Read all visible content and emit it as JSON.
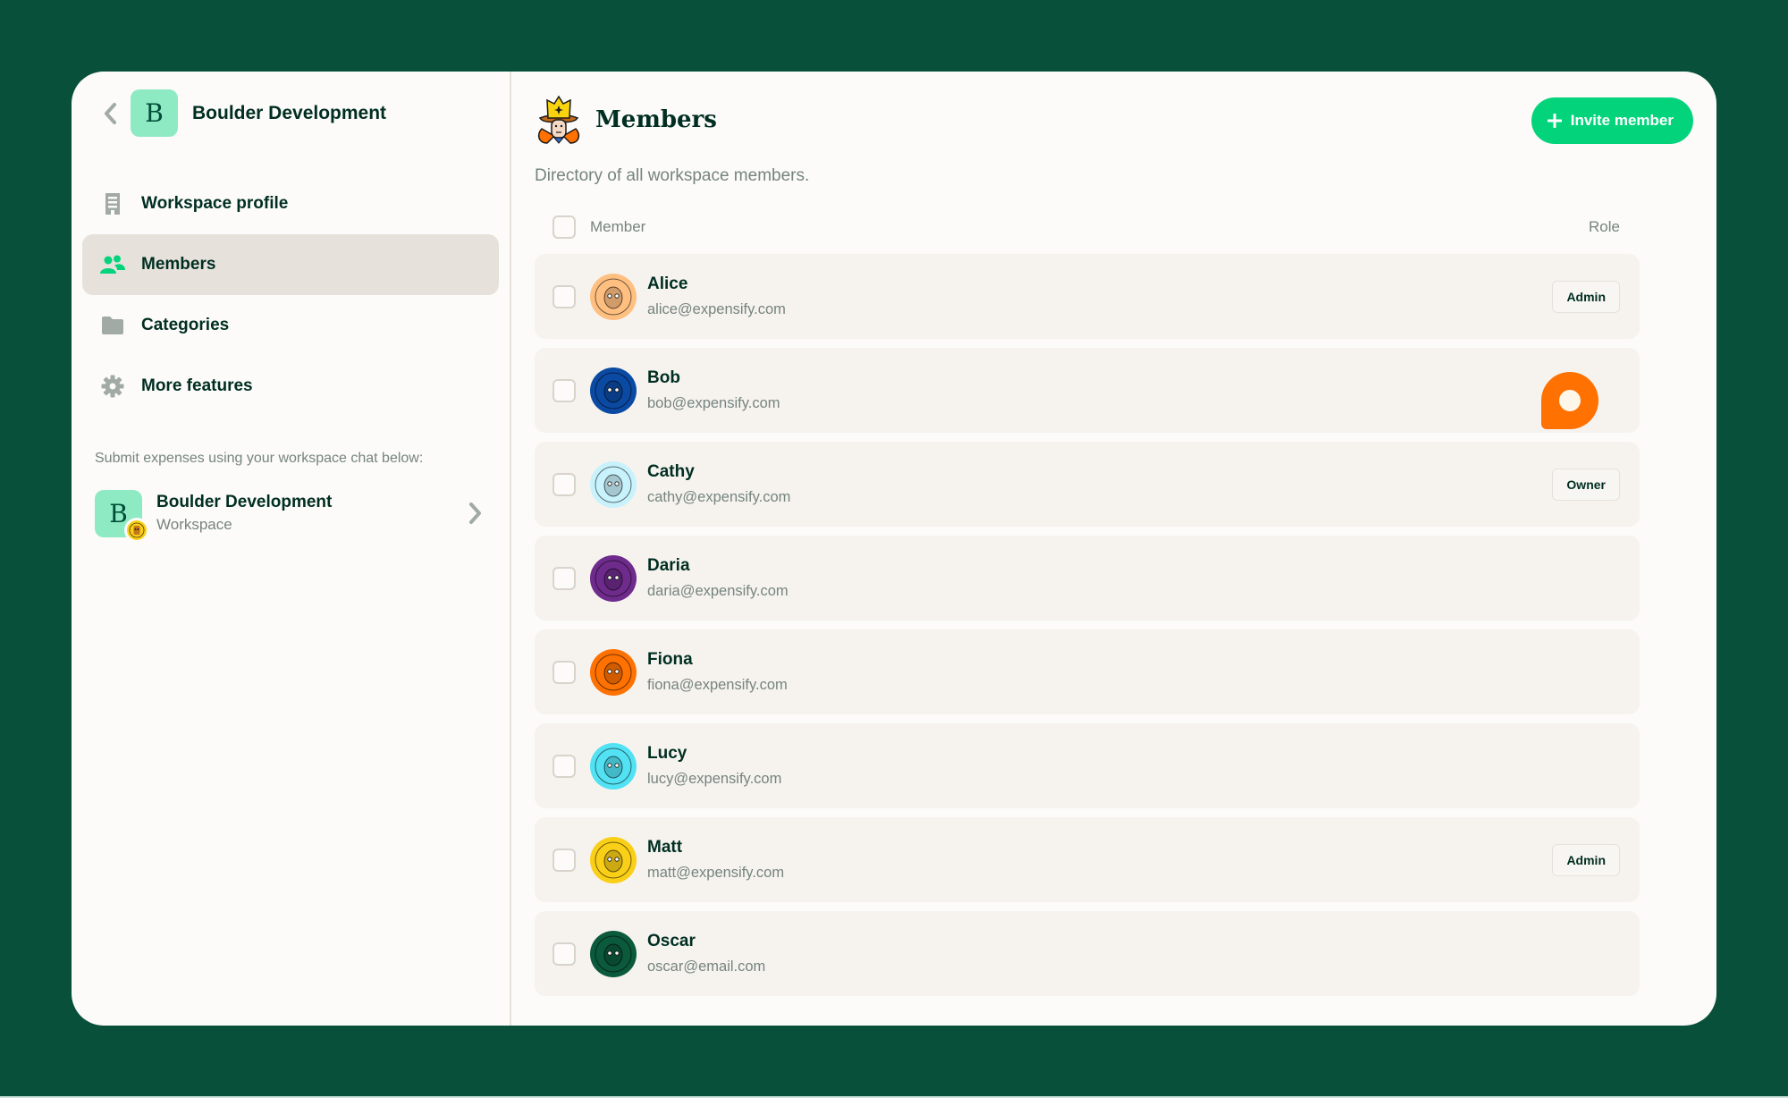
{
  "workspace": {
    "initial": "B",
    "name": "Boulder Development"
  },
  "sidebar": {
    "items": [
      {
        "label": "Workspace profile",
        "icon": "building-icon",
        "active": false
      },
      {
        "label": "Members",
        "icon": "users-icon",
        "active": true
      },
      {
        "label": "Categories",
        "icon": "folder-icon",
        "active": false
      },
      {
        "label": "More features",
        "icon": "gear-icon",
        "active": false
      }
    ],
    "submit_hint": "Submit expenses using your workspace chat below:",
    "chat": {
      "initial": "B",
      "title": "Boulder Development",
      "subtitle": "Workspace"
    }
  },
  "main": {
    "title": "Members",
    "invite_label": "Invite member",
    "description": "Directory of all workspace members.",
    "columns": {
      "member": "Member",
      "role": "Role"
    },
    "members": [
      {
        "name": "Alice",
        "email": "alice@expensify.com",
        "role": "Admin",
        "avatar_color": "#ffbf80"
      },
      {
        "name": "Bob",
        "email": "bob@expensify.com",
        "role": "",
        "avatar_color": "#0b4aa2"
      },
      {
        "name": "Cathy",
        "email": "cathy@expensify.com",
        "role": "Owner",
        "avatar_color": "#c8f2fc"
      },
      {
        "name": "Daria",
        "email": "daria@expensify.com",
        "role": "",
        "avatar_color": "#6e2b8c"
      },
      {
        "name": "Fiona",
        "email": "fiona@expensify.com",
        "role": "",
        "avatar_color": "#ff7101"
      },
      {
        "name": "Lucy",
        "email": "lucy@expensify.com",
        "role": "",
        "avatar_color": "#52e2f4"
      },
      {
        "name": "Matt",
        "email": "matt@expensify.com",
        "role": "Admin",
        "avatar_color": "#f9cf17"
      },
      {
        "name": "Oscar",
        "email": "oscar@email.com",
        "role": "",
        "avatar_color": "#0b5a3c"
      }
    ]
  },
  "colors": {
    "background": "#08503a",
    "accent": "#03d47c",
    "fab": "#ff7101",
    "text": "#002e22",
    "muted": "#76847e"
  }
}
